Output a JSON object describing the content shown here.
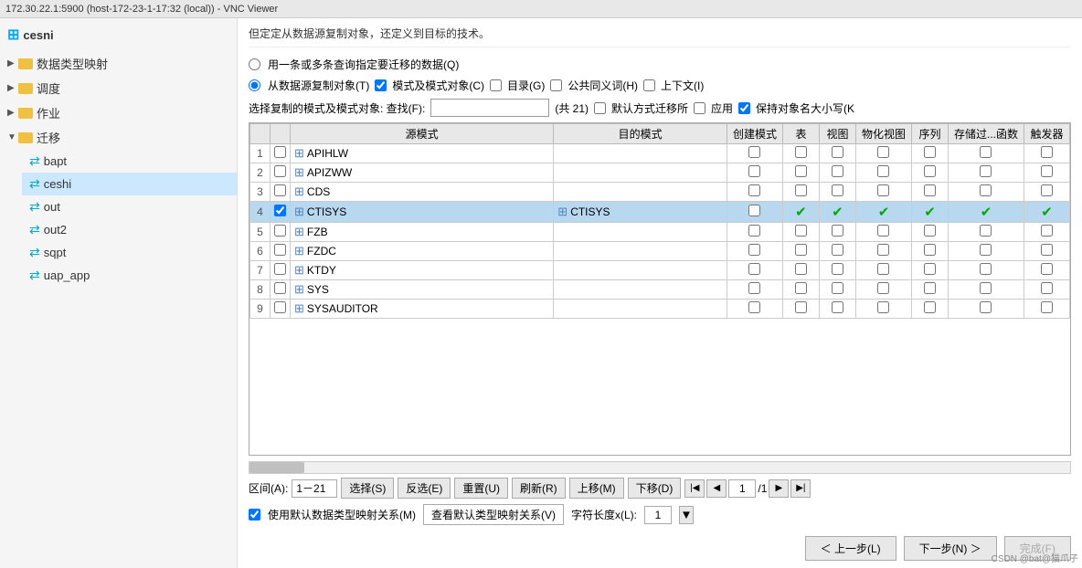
{
  "titleBar": {
    "text": "172.30.22.1:5900 (host-172-23-1-17:32 (local)) - VNC Viewer"
  },
  "appName": "cesni",
  "sidebar": {
    "items": [
      {
        "id": "data-mapping",
        "label": "数据类型映射",
        "type": "folder",
        "level": 0,
        "expanded": false
      },
      {
        "id": "schedule",
        "label": "调度",
        "type": "folder",
        "level": 0,
        "expanded": false
      },
      {
        "id": "job",
        "label": "作业",
        "type": "folder",
        "level": 0,
        "expanded": false
      },
      {
        "id": "migration",
        "label": "迁移",
        "type": "folder",
        "level": 0,
        "expanded": true
      },
      {
        "id": "bapt",
        "label": "bapt",
        "type": "sync",
        "level": 1
      },
      {
        "id": "ceshi",
        "label": "ceshi",
        "type": "sync",
        "level": 1,
        "selected": true
      },
      {
        "id": "out",
        "label": "out",
        "type": "sync",
        "level": 1
      },
      {
        "id": "out2",
        "label": "out2",
        "type": "sync",
        "level": 1
      },
      {
        "id": "sqpt",
        "label": "sqpt",
        "type": "sync",
        "level": 1
      },
      {
        "id": "uap_app",
        "label": "uap_app",
        "type": "sync",
        "level": 1
      }
    ]
  },
  "content": {
    "description": "但定定从数据源复制对象，还定义到目标的技术。",
    "radioOption1": "用一条或多条查询指定要迁移的数据(Q)",
    "radioOption2": "从数据源复制对象(T)",
    "checkboxModeObj": "模式及模式对象(C)",
    "checkboxDir": "目录(G)",
    "checkboxSynonym": "公共同义词(H)",
    "checkboxContext": "上下文(I)",
    "searchLabel": "选择复制的模式及模式对象: 查找(F):",
    "searchPlaceholder": "",
    "countText": "(共 21)",
    "checkboxDefault": "默认方式迁移所",
    "checkboxApply": "应用",
    "checkboxKeepCase": "保持对象名大小写(K",
    "tableHeaders": [
      "",
      "",
      "源模式",
      "目的模式",
      "创建模式",
      "表",
      "视图",
      "物化视图",
      "序列",
      "存储过...函数",
      "触发器"
    ],
    "tableRows": [
      {
        "num": 1,
        "checked": false,
        "source": "APIHLW",
        "target": "",
        "createMode": false,
        "table": false,
        "view": false,
        "matView": false,
        "sequence": false,
        "storedFunc": false,
        "trigger": false
      },
      {
        "num": 2,
        "checked": false,
        "source": "APIZWW",
        "target": "",
        "createMode": false,
        "table": false,
        "view": false,
        "matView": false,
        "sequence": false,
        "storedFunc": false,
        "trigger": false
      },
      {
        "num": 3,
        "checked": false,
        "source": "CDS",
        "target": "",
        "createMode": false,
        "table": false,
        "view": false,
        "matView": false,
        "sequence": false,
        "storedFunc": false,
        "trigger": false
      },
      {
        "num": 4,
        "checked": true,
        "source": "CTISYS",
        "target": "CTISYS",
        "createMode": false,
        "table": true,
        "view": true,
        "matView": true,
        "sequence": true,
        "storedFunc": true,
        "trigger": true,
        "selected": true
      },
      {
        "num": 5,
        "checked": false,
        "source": "FZB",
        "target": "",
        "createMode": false,
        "table": false,
        "view": false,
        "matView": false,
        "sequence": false,
        "storedFunc": false,
        "trigger": false
      },
      {
        "num": 6,
        "checked": false,
        "source": "FZDC",
        "target": "",
        "createMode": false,
        "table": false,
        "view": false,
        "matView": false,
        "sequence": false,
        "storedFunc": false,
        "trigger": false
      },
      {
        "num": 7,
        "checked": false,
        "source": "KTDY",
        "target": "",
        "createMode": false,
        "table": false,
        "view": false,
        "matView": false,
        "sequence": false,
        "storedFunc": false,
        "trigger": false
      },
      {
        "num": 8,
        "checked": false,
        "source": "SYS",
        "target": "",
        "createMode": false,
        "table": false,
        "view": false,
        "matView": false,
        "sequence": false,
        "storedFunc": false,
        "trigger": false
      },
      {
        "num": 9,
        "checked": false,
        "source": "SYSAUDITOR",
        "target": "",
        "createMode": false,
        "table": false,
        "view": false,
        "matView": false,
        "sequence": false,
        "storedFunc": false,
        "trigger": false
      }
    ],
    "toolbar": {
      "rangeLabel": "区间(A):",
      "rangeValue": "1－21",
      "selectBtn": "选择(S)",
      "deselectBtn": "反选(E)",
      "resetBtn": "重置(U)",
      "refreshBtn": "刷新(R)",
      "moveUpBtn": "上移(M)",
      "moveDownBtn": "下移(D)",
      "pageValue": "1",
      "pageTotalText": "/1"
    },
    "bottomOptions": {
      "useDefaultMapping": "使用默认数据类型映射关系(M)",
      "viewDefaultMapping": "查看默认类型映射关系(V)",
      "charLengthLabel": "字符长度x(L):",
      "charLengthValue": "1"
    },
    "actionButtons": {
      "prev": "＜ 上一步(L)",
      "next": "下一步(N) ＞",
      "finish": "完成(F)"
    }
  }
}
